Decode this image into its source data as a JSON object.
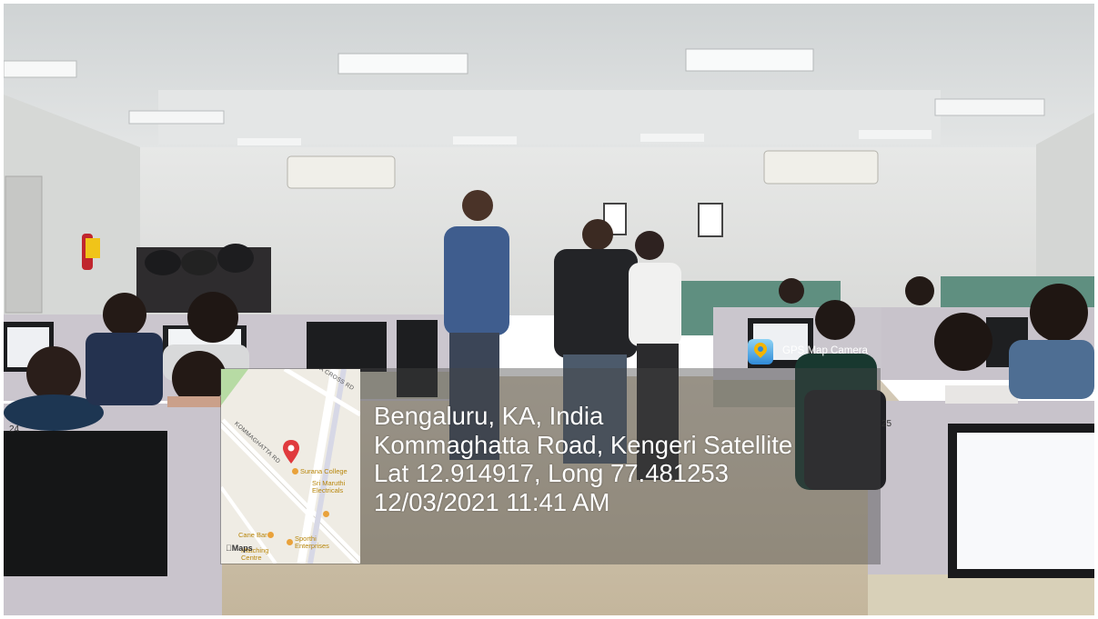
{
  "overlay": {
    "app_name": "GPS Map Camera",
    "location_line": "Bengaluru, KA, India",
    "address_line": "Kommaghatta Road, Kengeri Satellite",
    "coords_line": "Lat 12.914917, Long 77.481253",
    "timestamp_line": "12/03/2021 11:41 AM"
  },
  "map": {
    "street_1": "1ST A CROSS RD",
    "street_2": "KOMMAGHATTA RD",
    "poi_1": "Surana College",
    "poi_2": "Sri Maruthi Electricals",
    "poi_3": "Cane Bar",
    "poi_4": "Sporthi Enterprises",
    "poi_5": "Matching Centre",
    "attribution": "Maps"
  },
  "scene": {
    "desk_number_left": "24",
    "desk_number_right": "25"
  },
  "colors": {
    "ceiling": "#d9dcdc",
    "wall": "#e2e3e2",
    "floor": "#cfc4b0",
    "partition": "#c9c4cc",
    "panel_green": "#5f8f80",
    "map_pin": "#e03a3e",
    "map_poi": "#e9a23b"
  }
}
